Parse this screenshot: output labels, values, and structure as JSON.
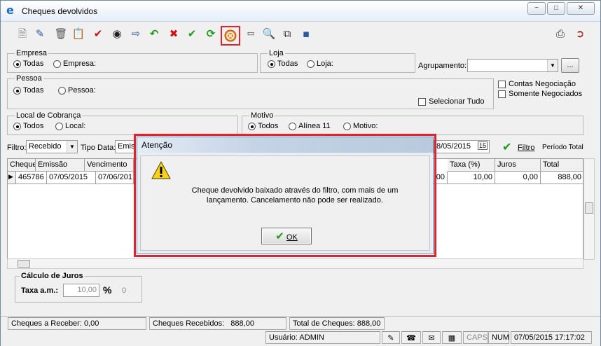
{
  "window": {
    "title": "Cheques devolvidos",
    "controls": [
      "−",
      "□",
      "✕"
    ]
  },
  "toolbar": {
    "icons": [
      "new-document-icon",
      "edit-icon",
      "delete-icon",
      "print-preview-icon",
      "check-red-icon",
      "binoculars-icon",
      "export-icon",
      "undo-icon",
      "cancel-icon",
      "confirm-icon",
      "refresh-icon",
      "cancel-settlement-icon",
      "report-icon",
      "zoom-icon",
      "copy-icon",
      "eraser-icon",
      "printer-icon",
      "exit-icon"
    ]
  },
  "filters": {
    "empresa": {
      "title": "Empresa",
      "option_all": "Todas",
      "option_one": "Empresa:"
    },
    "loja": {
      "title": "Loja",
      "option_all": "Todas",
      "option_one": "Loja:"
    },
    "agrupamento_label": "Agrupamento:",
    "agrupamento_button": "...",
    "pessoa": {
      "title": "Pessoa",
      "option_all": "Todas",
      "option_one": "Pessoa:"
    },
    "contas_negociacao": "Contas Negociação",
    "somente_negociados": "Somente Negociados",
    "selecionar_tudo": "Selecionar Tudo",
    "local_cobranca": {
      "title": "Local de Cobrança",
      "option_all": "Todos",
      "option_one": "Local:"
    },
    "motivo": {
      "title": "Motivo",
      "option_all": "Todos",
      "option_alinea": "Alínea 11",
      "option_one": "Motivo:"
    },
    "filtro_label": "Filtro:",
    "filtro_value": "Recebido",
    "tipo_data_label": "Tipo Data:",
    "tipo_data_value": "Emiss",
    "date_value": "8/05/2015",
    "filtro_button": "Filtro",
    "periodo_total_button": "Período Total"
  },
  "grid": {
    "columns_left": [
      "Cheque",
      "Emissão",
      "Vencimento"
    ],
    "columns_right": [
      "Taxa (%)",
      "Juros",
      "Total"
    ],
    "rows": [
      {
        "cheque": "465786",
        "emissao": "07/05/2015",
        "vencimento": "07/06/201",
        "hidden_val": ",00",
        "taxa": "10,00",
        "juros": "0,00",
        "total": "888,00"
      }
    ]
  },
  "juros": {
    "title": "Cálculo de Juros",
    "taxa_label": "Taxa a.m.:",
    "taxa_value": "10,00",
    "percent": "%",
    "zero": "0"
  },
  "status": {
    "a_receber": "Cheques a Receber:",
    "a_receber_val": "0,00",
    "recebidos": "Cheques Recebidos:",
    "recebidos_val": "888,00",
    "total": "Total de Cheques:",
    "total_val": "888,00",
    "usuario": "Usuário: ADMIN",
    "caps": "CAPS",
    "num": "NUM",
    "datetime": "07/05/2015 17:17:02"
  },
  "dialog": {
    "title": "Atenção",
    "message": "Cheque devolvido baixado através do filtro, com mais de um lançamento. Cancelamento não pode ser realizado.",
    "ok_label": "OK"
  }
}
